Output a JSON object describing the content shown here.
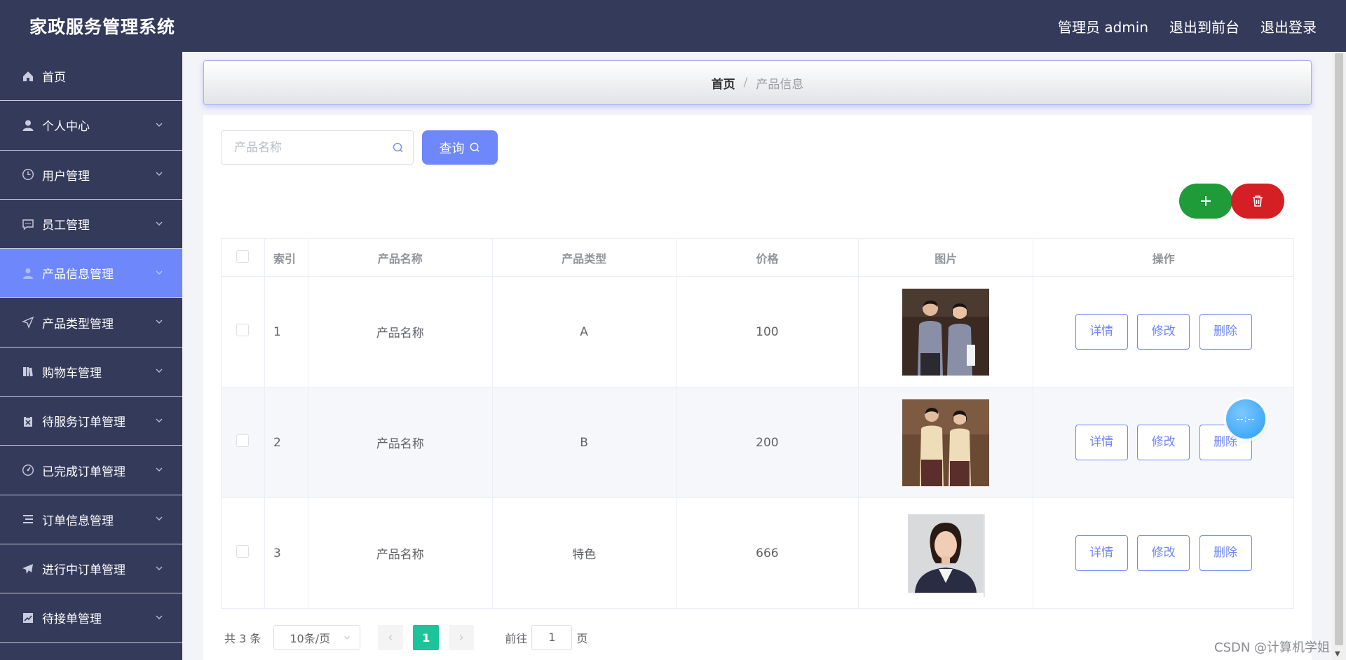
{
  "header": {
    "brand": "家政服务管理系统",
    "admin_label": "管理员 admin",
    "back_to_front": "退出到前台",
    "logout": "退出登录"
  },
  "sidebar": {
    "items": [
      {
        "label": "首页",
        "icon": "home-icon",
        "has_chevron": false
      },
      {
        "label": "个人中心",
        "icon": "user-icon",
        "has_chevron": true
      },
      {
        "label": "用户管理",
        "icon": "clock-icon",
        "has_chevron": true
      },
      {
        "label": "员工管理",
        "icon": "chat-icon",
        "has_chevron": true
      },
      {
        "label": "产品信息管理",
        "icon": "person-icon",
        "has_chevron": true,
        "active": true
      },
      {
        "label": "产品类型管理",
        "icon": "send-icon",
        "has_chevron": true
      },
      {
        "label": "购物车管理",
        "icon": "books-icon",
        "has_chevron": true
      },
      {
        "label": "待服务订单管理",
        "icon": "clipboard-icon",
        "has_chevron": true
      },
      {
        "label": "已完成订单管理",
        "icon": "gauge-icon",
        "has_chevron": true
      },
      {
        "label": "订单信息管理",
        "icon": "list-icon",
        "has_chevron": true
      },
      {
        "label": "进行中订单管理",
        "icon": "plane-icon",
        "has_chevron": true
      },
      {
        "label": "待接单管理",
        "icon": "chart-icon",
        "has_chevron": true
      }
    ]
  },
  "breadcrumb": {
    "home": "首页",
    "separator": "/",
    "current": "产品信息"
  },
  "search": {
    "placeholder": "产品名称",
    "value": "",
    "query_label": "查询"
  },
  "table": {
    "headers": [
      "索引",
      "产品名称",
      "产品类型",
      "价格",
      "图片",
      "操作"
    ],
    "rows": [
      {
        "index": "1",
        "name": "产品名称",
        "type": "A",
        "price": "100",
        "image": "two-staff-gray-uniform"
      },
      {
        "index": "2",
        "name": "产品名称",
        "type": "B",
        "price": "200",
        "image": "two-staff-beige-uniform"
      },
      {
        "index": "3",
        "name": "产品名称",
        "type": "特色",
        "price": "666",
        "image": "woman-portrait"
      }
    ],
    "actions": {
      "detail": "详情",
      "edit": "修改",
      "delete": "删除"
    }
  },
  "pagination": {
    "total": "共 3 条",
    "page_size": "10条/页",
    "current_page": "1",
    "goto_prefix": "前往",
    "goto_value": "1",
    "goto_suffix": "页"
  },
  "float_ball": "--:--",
  "watermark": "CSDN @计算机学姐",
  "colors": {
    "header_bg": "#343a5a",
    "accent": "#6e87fb",
    "add_green": "#1f9b3a",
    "delete_red": "#d41f24",
    "page_active": "#1ec499"
  }
}
